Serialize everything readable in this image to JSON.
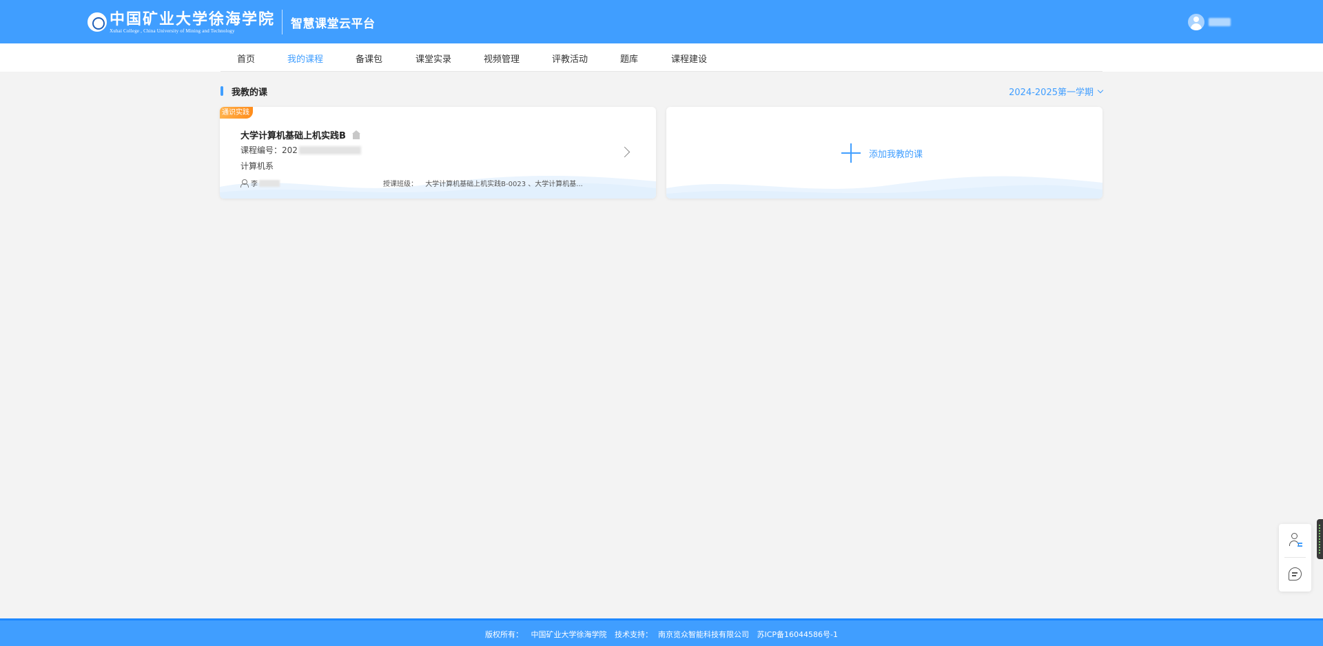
{
  "header": {
    "logo_cn": "中国矿业大学徐海学院",
    "logo_en": "Xuhai College , China University of Mining and Technology",
    "platform_title": "智慧课堂云平台"
  },
  "nav": {
    "items": [
      {
        "label": "首页",
        "active": false
      },
      {
        "label": "我的课程",
        "active": true
      },
      {
        "label": "备课包",
        "active": false
      },
      {
        "label": "课堂实录",
        "active": false
      },
      {
        "label": "视频管理",
        "active": false
      },
      {
        "label": "评教活动",
        "active": false
      },
      {
        "label": "题库",
        "active": false
      },
      {
        "label": "课程建设",
        "active": false
      }
    ]
  },
  "section": {
    "title": "我教的课",
    "term": "2024-2025第一学期"
  },
  "course_card": {
    "tag": "通识实践",
    "name": "大学计算机基础上机实践B",
    "code_label": "课程编号：",
    "code_visible": "202",
    "department": "计算机系",
    "teacher_visible": "李",
    "classes_label": "授课班级：",
    "classes_value": "大学计算机基础上机实践B-0023 、大学计算机基..."
  },
  "add_card": {
    "label": "添加我教的课"
  },
  "footer": {
    "copyright_label": "版权所有：",
    "copyright_value": "中国矿业大学徐海学院",
    "support_label": "技术支持：",
    "support_value": "南京览众智能科技有限公司",
    "icp": "苏ICP备16044586号-1"
  },
  "colors": {
    "primary": "#409eff",
    "tag_orange": "#ff8c1a",
    "background": "#f3f3f3"
  }
}
